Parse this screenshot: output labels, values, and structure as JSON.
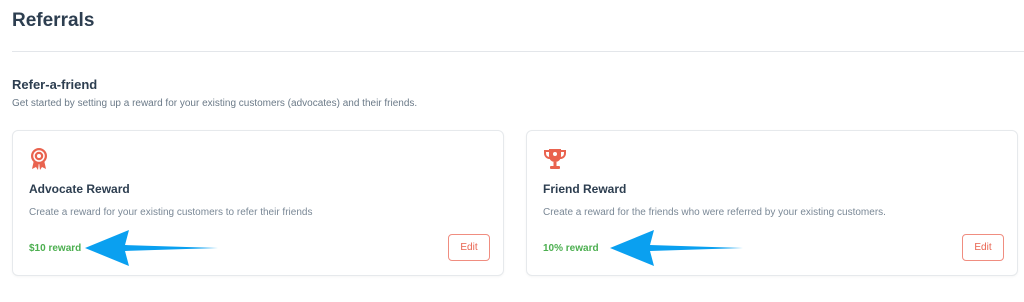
{
  "header": {
    "title": "Referrals"
  },
  "section": {
    "title": "Refer-a-friend",
    "description": "Get started by setting up a reward for your existing customers (advocates) and their friends."
  },
  "cards": [
    {
      "icon": "award-badge-icon",
      "title": "Advocate Reward",
      "description": "Create a reward for your existing customers to refer their friends",
      "reward": "$10 reward",
      "edit_label": "Edit"
    },
    {
      "icon": "trophy-icon",
      "title": "Friend Reward",
      "description": "Create a reward for the friends who were referred by your existing customers.",
      "reward": "10% reward",
      "edit_label": "Edit"
    }
  ],
  "colors": {
    "accent": "#e9634f",
    "reward_green": "#4caf50",
    "annotation_arrow": "#0aa0f0"
  }
}
